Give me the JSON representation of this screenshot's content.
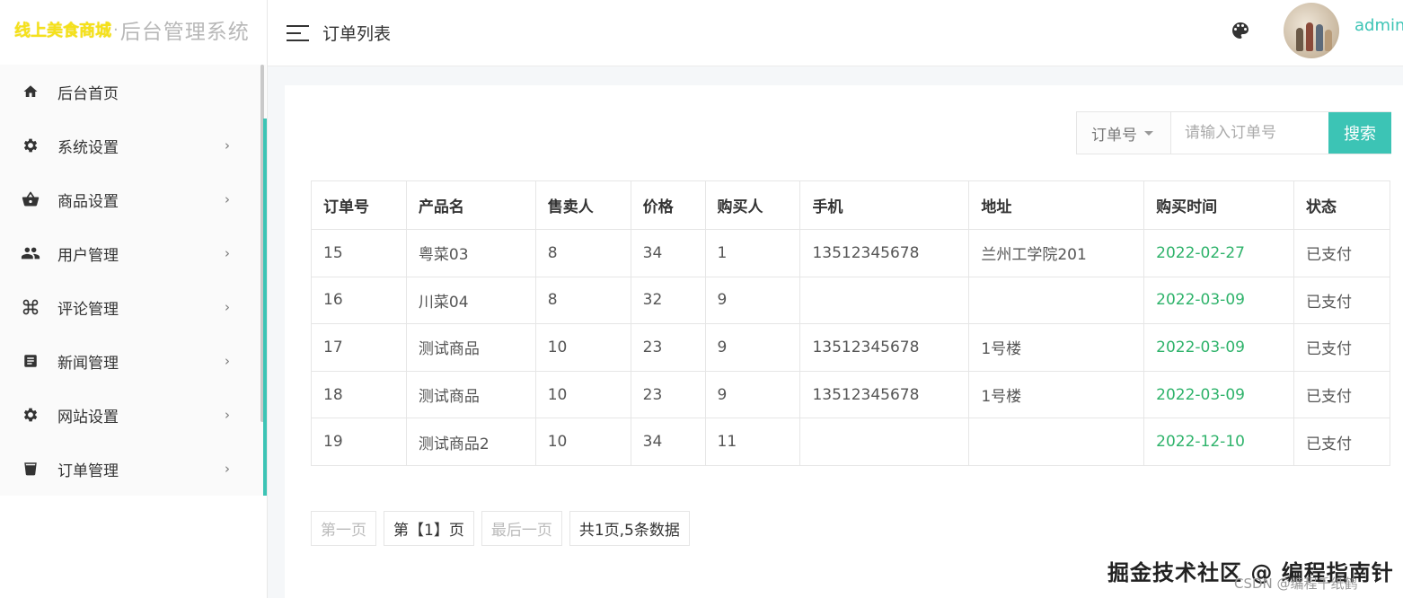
{
  "brand": {
    "main": "线上美食商城",
    "dot": "·",
    "sub": "后台管理系统"
  },
  "header": {
    "title": "订单列表",
    "username": "admin"
  },
  "sidebar": {
    "items": [
      {
        "label": "后台首页",
        "icon": "home-icon"
      },
      {
        "label": "系统设置",
        "icon": "gear-icon"
      },
      {
        "label": "商品设置",
        "icon": "basket-icon"
      },
      {
        "label": "用户管理",
        "icon": "users-icon"
      },
      {
        "label": "评论管理",
        "icon": "command-icon"
      },
      {
        "label": "新闻管理",
        "icon": "article-icon"
      },
      {
        "label": "网站设置",
        "icon": "gear-icon"
      },
      {
        "label": "订单管理",
        "icon": "cup-icon"
      }
    ],
    "arrow": "›"
  },
  "search": {
    "select_label": "订单号",
    "placeholder": "请输入订单号",
    "button": "搜索"
  },
  "table": {
    "headers": [
      "订单号",
      "产品名",
      "售卖人",
      "价格",
      "购买人",
      "手机",
      "地址",
      "购买时间",
      "状态"
    ],
    "rows": [
      [
        "15",
        "粤菜03",
        "8",
        "34",
        "1",
        "13512345678",
        "兰州工学院201",
        "2022-02-27",
        "已支付"
      ],
      [
        "16",
        "川菜04",
        "8",
        "32",
        "9",
        "",
        "",
        "2022-03-09",
        "已支付"
      ],
      [
        "17",
        "测试商品",
        "10",
        "23",
        "9",
        "13512345678",
        "1号楼",
        "2022-03-09",
        "已支付"
      ],
      [
        "18",
        "测试商品",
        "10",
        "23",
        "9",
        "13512345678",
        "1号楼",
        "2022-03-09",
        "已支付"
      ],
      [
        "19",
        "测试商品2",
        "10",
        "34",
        "11",
        "",
        "",
        "2022-12-10",
        "已支付"
      ]
    ]
  },
  "pager": {
    "first": "第一页",
    "current": "第【1】页",
    "last": "最后一页",
    "summary": "共1页,5条数据"
  },
  "watermark": {
    "main": "掘金技术社区 @ 编程指南针",
    "sub": "CSDN @编程千纸鹤"
  },
  "colors": {
    "accent": "#3cc4b5",
    "date": "#2fb36b",
    "brand": "#f5e11a"
  }
}
